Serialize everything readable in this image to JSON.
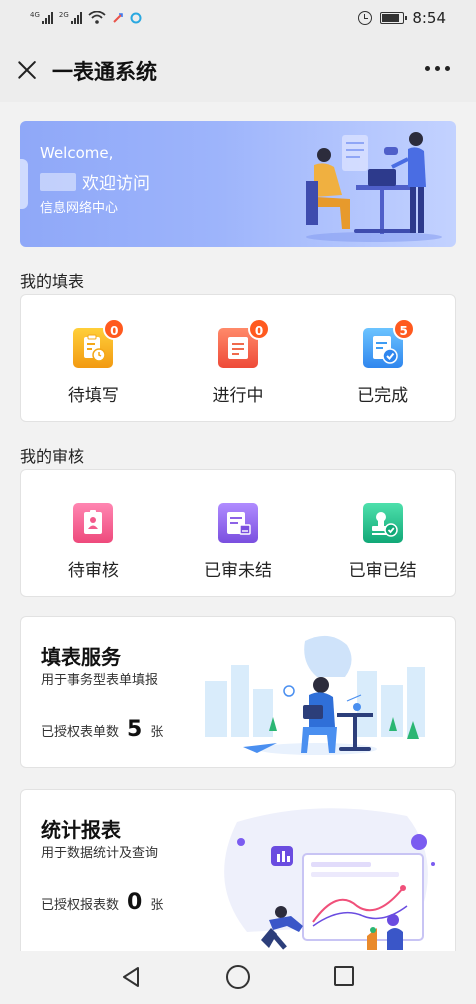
{
  "status_bar": {
    "signal_1_tag": "4G",
    "signal_2_tag": "2G",
    "time": "8:54",
    "icons": [
      "signal-icon",
      "wifi-icon",
      "alarm-icon",
      "battery-icon"
    ]
  },
  "nav": {
    "title": "一表通系统"
  },
  "banner": {
    "welcome": "Welcome,",
    "greeting": "欢迎访问",
    "org": "信息网络中心"
  },
  "my_forms": {
    "title": "我的填表",
    "items": [
      {
        "label": "待填写",
        "badge": "0",
        "icon": "clipboard-clock-icon",
        "color": "#f6b21a"
      },
      {
        "label": "进行中",
        "badge": "0",
        "icon": "edit-doc-icon",
        "color": "#f2664a"
      },
      {
        "label": "已完成",
        "badge": "5",
        "icon": "doc-check-icon",
        "color": "#3d9cf3"
      }
    ]
  },
  "my_review": {
    "title": "我的审核",
    "items": [
      {
        "label": "待审核",
        "icon": "badge-card-icon",
        "color": "#f35b8c"
      },
      {
        "label": "已审未结",
        "icon": "doc-stamp-icon",
        "color": "#8d62e6"
      },
      {
        "label": "已审已结",
        "icon": "stamp-check-icon",
        "color": "#18c38c"
      }
    ]
  },
  "form_service": {
    "title": "填表服务",
    "subtitle": "用于事务型表单填报",
    "count_prefix": "已授权表单数",
    "count": "5",
    "count_unit": "张"
  },
  "stats_report": {
    "title": "统计报表",
    "subtitle": "用于数据统计及查询",
    "count_prefix": "已授权报表数",
    "count": "0",
    "count_unit": "张"
  },
  "system_nav": {
    "icons": [
      "back-icon",
      "home-icon",
      "recent-apps-icon"
    ]
  }
}
